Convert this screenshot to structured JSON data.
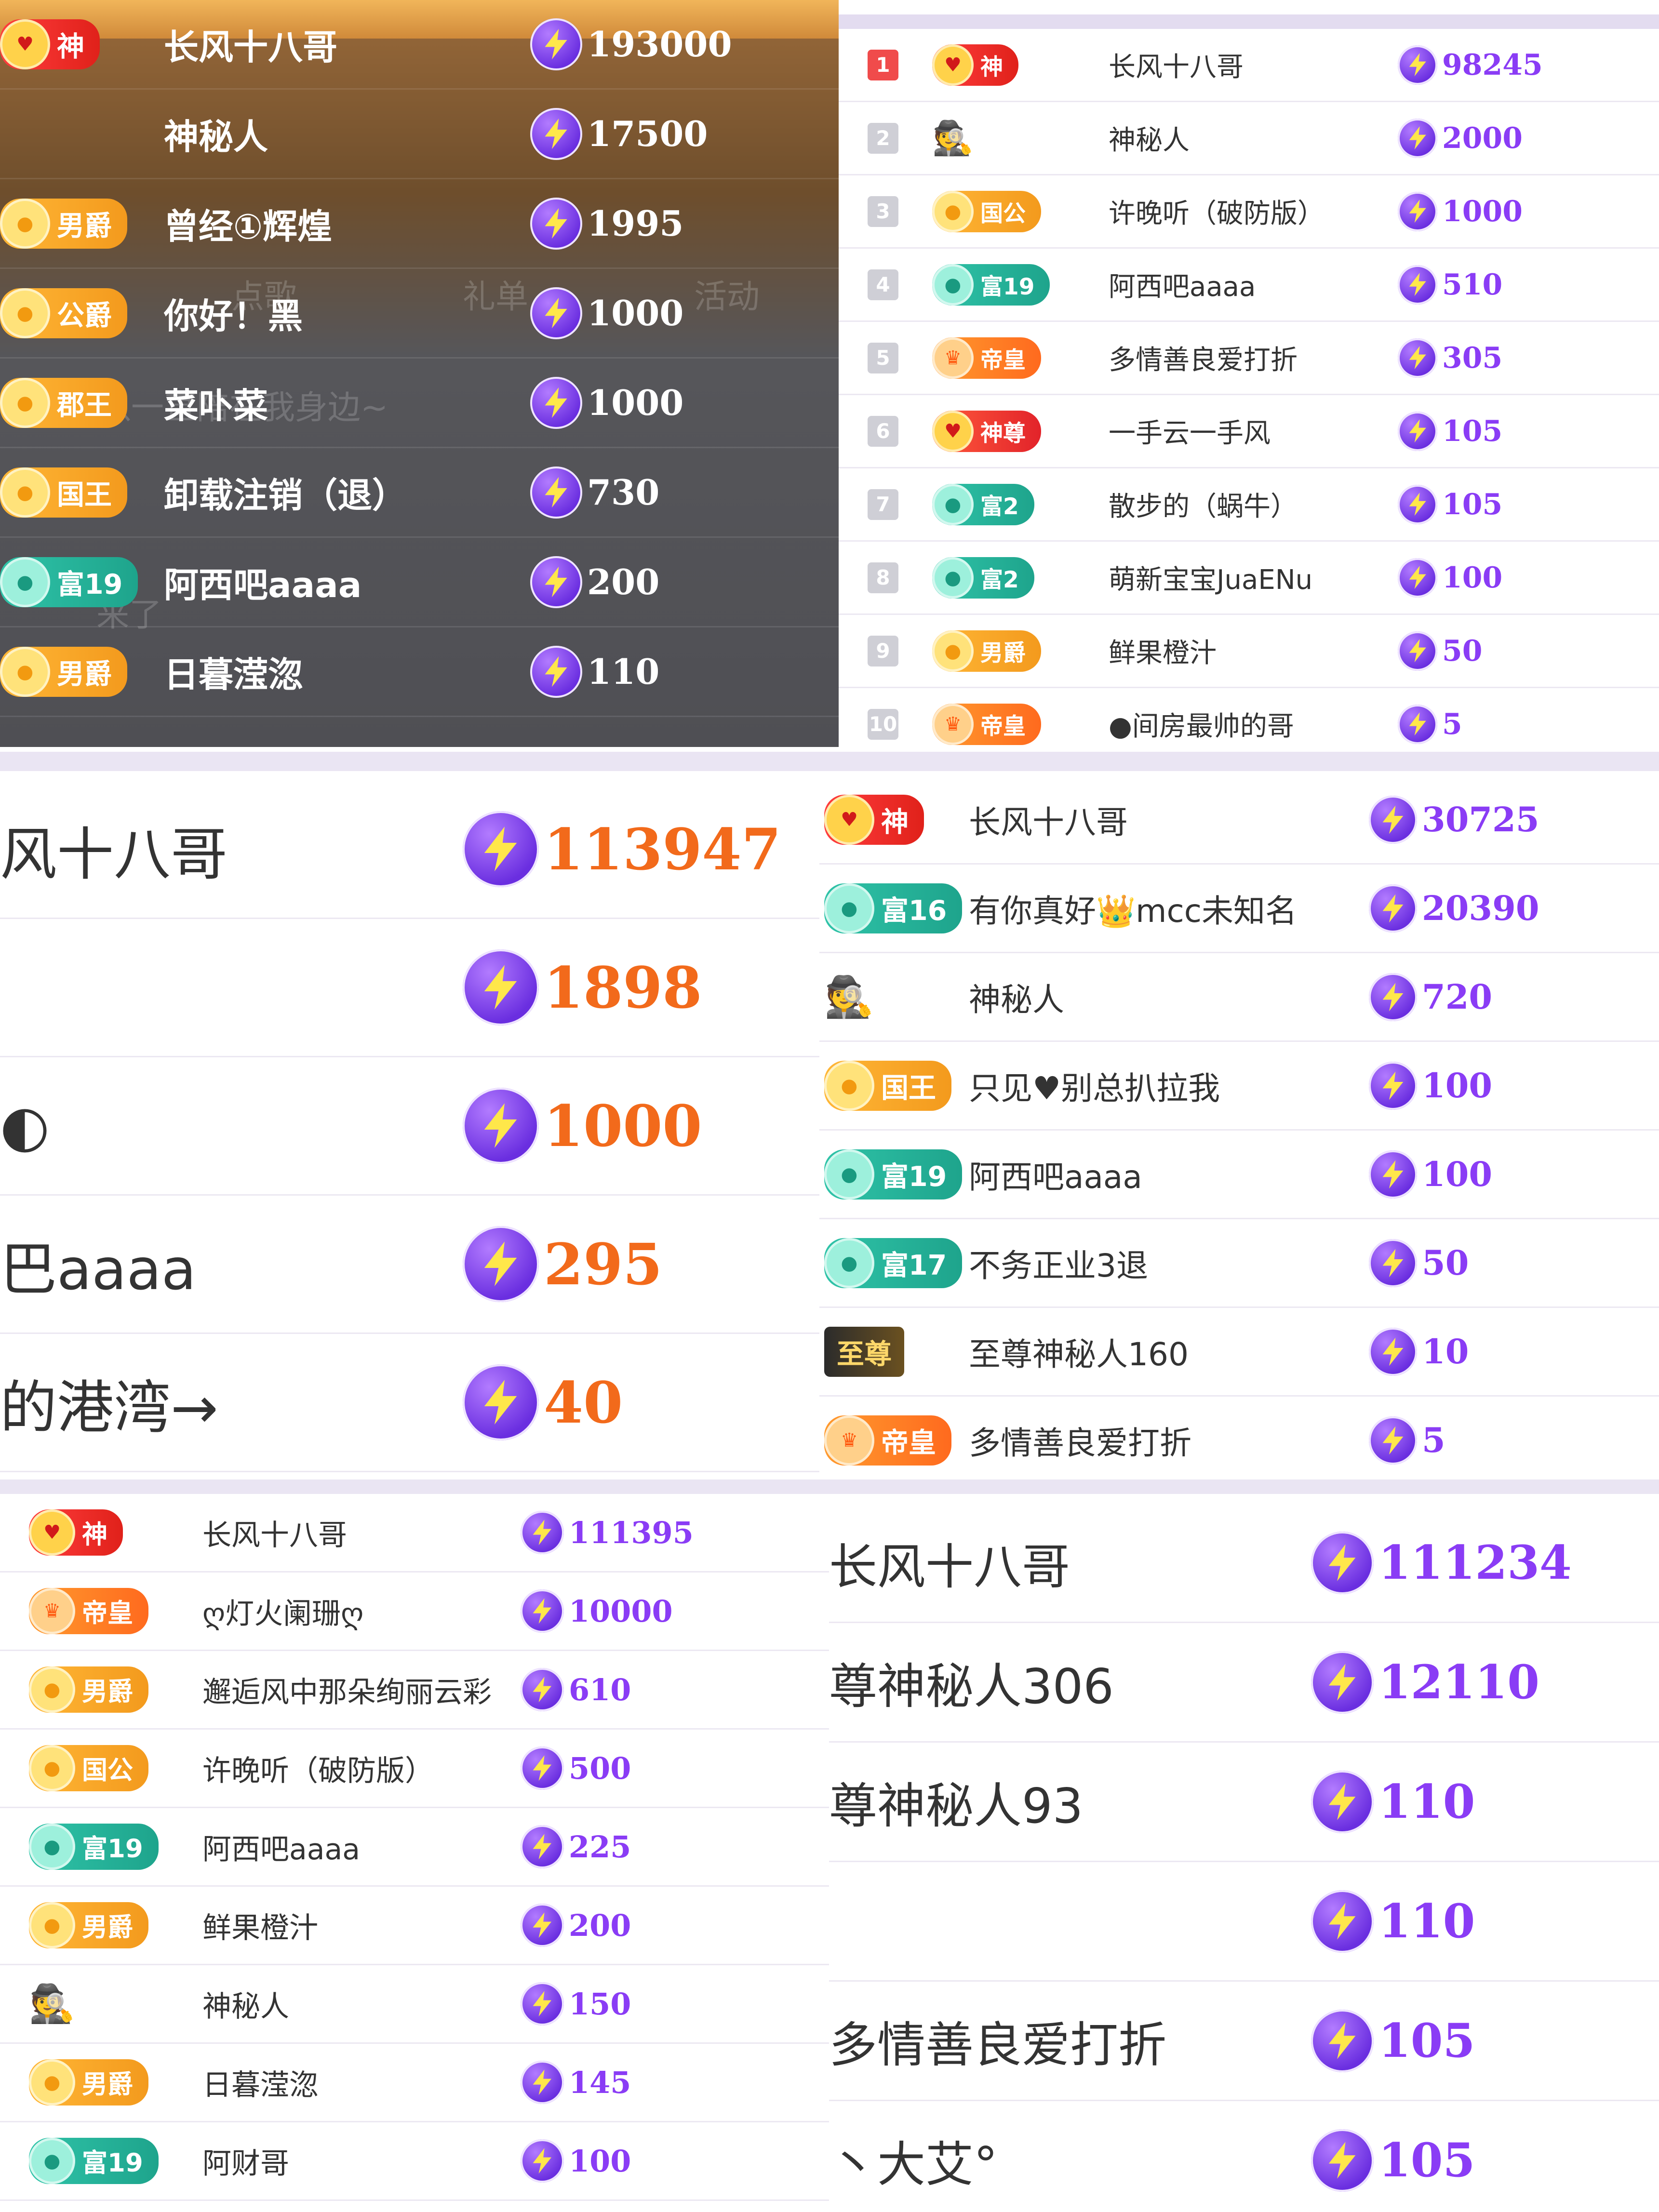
{
  "panels": {
    "p1": {
      "rows": [
        {
          "badge": "神",
          "style": "god",
          "name": "长风十八哥",
          "value": "193000"
        },
        {
          "badge": "",
          "style": "none",
          "name": "神秘人",
          "value": "17500"
        },
        {
          "badge": "男爵",
          "style": "gold",
          "name": "曾经①辉煌",
          "value": "1995"
        },
        {
          "badge": "公爵",
          "style": "gold",
          "name": "你好！黑",
          "value": "1000"
        },
        {
          "badge": "郡王",
          "style": "gold",
          "name": "菜卟菜",
          "value": "1000"
        },
        {
          "badge": "国王",
          "style": "gold",
          "name": "卸载注销（退）",
          "value": "730"
        },
        {
          "badge": "富19",
          "style": "teal",
          "name": "阿西吧aaaa",
          "value": "200"
        },
        {
          "badge": "男爵",
          "style": "gold",
          "name": "日暮滢淴",
          "value": "110"
        }
      ],
      "watermarks": [
        "点歌",
        "礼单",
        "活动",
        "可不可以一直陪在我身边~",
        "来了"
      ]
    },
    "p2": {
      "rows": [
        {
          "rank": "1",
          "badge": "神",
          "style": "god",
          "name": "长风十八哥",
          "value": "98245"
        },
        {
          "rank": "2",
          "badge": "",
          "style": "incognito",
          "name": "神秘人",
          "value": "2000"
        },
        {
          "rank": "3",
          "badge": "国公",
          "style": "gold",
          "name": "许晚听（破防版）",
          "value": "1000"
        },
        {
          "rank": "4",
          "badge": "富19",
          "style": "teal",
          "name": "阿西吧aaaa",
          "value": "510"
        },
        {
          "rank": "5",
          "badge": "帝皇",
          "style": "emperor",
          "name": "多情善良爱打折",
          "value": "305"
        },
        {
          "rank": "6",
          "badge": "神尊",
          "style": "magenta",
          "name": "一手云一手风",
          "value": "105"
        },
        {
          "rank": "7",
          "badge": "富2",
          "style": "teal",
          "name": "散步的（蜗牛）",
          "value": "105"
        },
        {
          "rank": "8",
          "badge": "富2",
          "style": "teal",
          "name": "萌新宝宝JuaENu",
          "value": "100"
        },
        {
          "rank": "9",
          "badge": "男爵",
          "style": "gold",
          "name": "鲜果橙汁",
          "value": "50"
        },
        {
          "rank": "10",
          "badge": "帝皇",
          "style": "emperor",
          "name": "●间房最帅的哥",
          "value": "5"
        }
      ]
    },
    "p3": {
      "rows": [
        {
          "name": "风十八哥",
          "value": "113947"
        },
        {
          "name": "",
          "value": "1898"
        },
        {
          "name": "◐",
          "value": "1000"
        },
        {
          "name": "巴aaaa",
          "value": "295"
        },
        {
          "name": "的港湾→",
          "value": "40"
        }
      ]
    },
    "p4": {
      "rows": [
        {
          "badge": "神",
          "style": "god",
          "name": "长风十八哥",
          "value": "30725"
        },
        {
          "badge": "富16",
          "style": "teal",
          "name": "有你真好👑mcc未知名",
          "value": "20390"
        },
        {
          "badge": "",
          "style": "incognito",
          "name": "神秘人",
          "value": "720"
        },
        {
          "badge": "国王",
          "style": "gold",
          "name": "只见♥别总扒拉我",
          "value": "100"
        },
        {
          "badge": "富19",
          "style": "teal",
          "name": "阿西吧aaaa",
          "value": "100"
        },
        {
          "badge": "富17",
          "style": "teal",
          "name": "不务正业3退",
          "value": "50"
        },
        {
          "badge": "至尊",
          "style": "supreme",
          "name": "至尊神秘人160",
          "value": "10"
        },
        {
          "badge": "帝皇",
          "style": "emperor",
          "name": "多情善良爱打折",
          "value": "5"
        }
      ]
    },
    "p5": {
      "rows": [
        {
          "badge": "神",
          "style": "god",
          "name": "长风十八哥",
          "value": "111395"
        },
        {
          "badge": "帝皇",
          "style": "emperor",
          "name": "ღ灯火阑珊ღ",
          "value": "10000"
        },
        {
          "badge": "男爵",
          "style": "gold",
          "name": "邂逅风中那朵绚丽云彩",
          "value": "610"
        },
        {
          "badge": "国公",
          "style": "gold",
          "name": "许晚听（破防版）",
          "value": "500"
        },
        {
          "badge": "富19",
          "style": "teal",
          "name": "阿西吧aaaa",
          "value": "225"
        },
        {
          "badge": "男爵",
          "style": "gold",
          "name": "鲜果橙汁",
          "value": "200"
        },
        {
          "badge": "",
          "style": "incognito",
          "name": "神秘人",
          "value": "150"
        },
        {
          "badge": "男爵",
          "style": "gold",
          "name": "日暮滢淴",
          "value": "145"
        },
        {
          "badge": "富19",
          "style": "teal",
          "name": "阿财哥",
          "value": "100"
        }
      ]
    },
    "p6": {
      "rows": [
        {
          "name": "长风十八哥",
          "value": "111234"
        },
        {
          "name": "尊神秘人306",
          "value": "12110"
        },
        {
          "name": "尊神秘人93",
          "value": "110"
        },
        {
          "name": "",
          "value": "110"
        },
        {
          "name": "多情善良爱打折",
          "value": "105"
        },
        {
          "name": "丶大艾°",
          "value": "105"
        }
      ]
    }
  },
  "icons": {
    "currency": "lightning-coin-icon",
    "incognito": "incognito-icon"
  },
  "colors": {
    "value_purple": "#8a3cf5",
    "value_orange": "#f26a1b",
    "dark_panel": "#5a5a5f",
    "header_gold": "#e8a446"
  }
}
